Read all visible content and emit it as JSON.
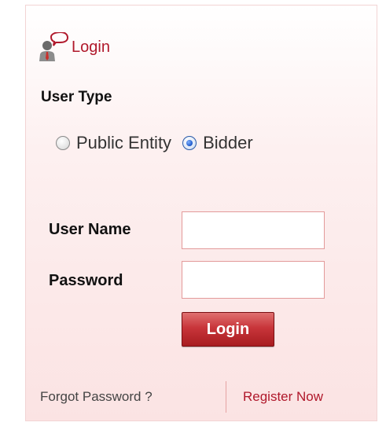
{
  "header": {
    "title": "Login",
    "icon": "user-login-icon"
  },
  "user_type": {
    "label": "User Type",
    "options": [
      {
        "label": "Public Entity",
        "selected": false
      },
      {
        "label": "Bidder",
        "selected": true
      }
    ]
  },
  "form": {
    "username_label": "User Name",
    "username_value": "",
    "password_label": "Password",
    "password_value": "",
    "login_button": "Login"
  },
  "footer": {
    "forgot_password": "Forgot Password ?",
    "register_now": "Register Now"
  },
  "colors": {
    "accent": "#b0182b",
    "button": "#c8353a",
    "input_border": "#e39a9a"
  }
}
